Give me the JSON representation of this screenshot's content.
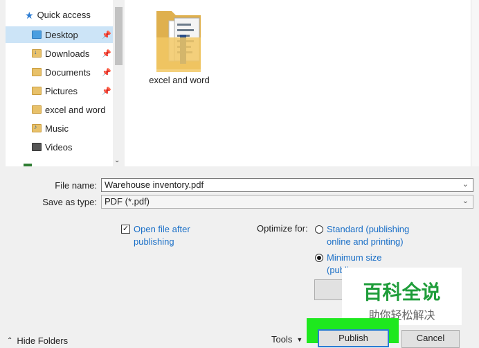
{
  "nav": {
    "quick_access": "Quick access",
    "items": [
      {
        "label": "Desktop",
        "icon": "desktop-icon",
        "pinned": true,
        "selected": true
      },
      {
        "label": "Downloads",
        "icon": "downloads-icon",
        "pinned": true
      },
      {
        "label": "Documents",
        "icon": "documents-icon",
        "pinned": true
      },
      {
        "label": "Pictures",
        "icon": "pictures-icon",
        "pinned": true
      },
      {
        "label": "excel and word",
        "icon": "folder-icon",
        "pinned": false
      },
      {
        "label": "Music",
        "icon": "music-icon",
        "pinned": false
      },
      {
        "label": "Videos",
        "icon": "videos-icon",
        "pinned": false
      }
    ]
  },
  "files": [
    {
      "label": "excel and word",
      "icon": "folder-icon"
    }
  ],
  "form": {
    "file_name_label": "File name:",
    "file_name_value": "Warehouse inventory.pdf",
    "save_type_label": "Save as type:",
    "save_type_value": "PDF (*.pdf)"
  },
  "options": {
    "open_after_line1": "Open file after",
    "open_after_line2": "publishing",
    "open_after_checked": true,
    "optimize_label": "Optimize for:",
    "standard_line1": "Standard (publishing",
    "standard_line2": "online and printing)",
    "minimum_line1": "Minimum size",
    "minimum_line2": "(publi",
    "selected_optimize": "minimum"
  },
  "footer": {
    "hide_folders": "Hide Folders",
    "tools": "Tools",
    "publish": "Publish",
    "cancel": "Cancel"
  },
  "watermark": {
    "line1": "百科全说",
    "line2": "助你轻松解决"
  },
  "colors": {
    "selection": "#cce4f7",
    "link": "#1a6fc7",
    "highlight_green": "#1ee81e"
  }
}
